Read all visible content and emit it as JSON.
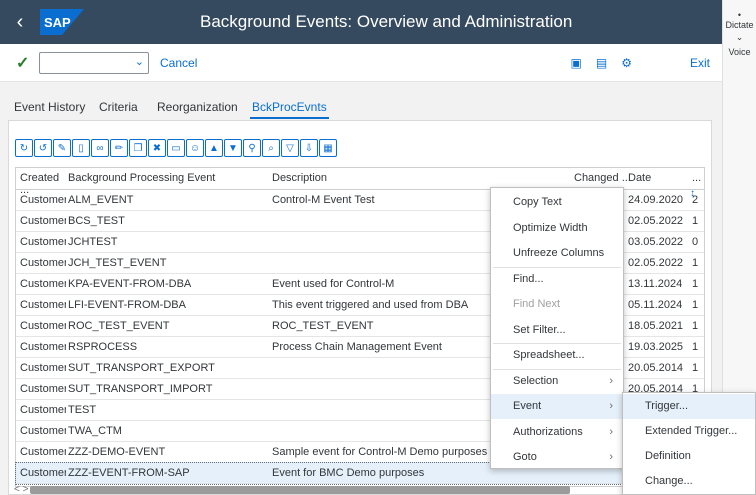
{
  "shell": {
    "title": "Background Events: Overview and Administration",
    "back_icon": "chevron-left-icon",
    "logo_text": "SAP"
  },
  "side_panel": {
    "dictate": "Dictate",
    "voice": "Voice"
  },
  "toolbar": {
    "cancel": "Cancel",
    "exit": "Exit",
    "command_value": ""
  },
  "tabs": [
    {
      "label": "Event History"
    },
    {
      "label": "Criteria"
    },
    {
      "label": "Reorganization"
    },
    {
      "label": "BckProcEvnts",
      "active": true
    }
  ],
  "table": {
    "columns": [
      "Created ...",
      "Background Processing Event",
      "Description",
      "Changed ...",
      "Date",
      "..."
    ],
    "rows": [
      {
        "created": "Customer",
        "event": "ALM_EVENT",
        "description": "Control-M Event Test",
        "date": "24.09.2020",
        "extra": "2"
      },
      {
        "created": "Customer",
        "event": "BCS_TEST",
        "description": "",
        "date": "02.05.2022",
        "extra": "1"
      },
      {
        "created": "Customer",
        "event": "JCHTEST",
        "description": "",
        "date": "03.05.2022",
        "extra": "0"
      },
      {
        "created": "Customer",
        "event": "JCH_TEST_EVENT",
        "description": "",
        "date": "02.05.2022",
        "extra": "1"
      },
      {
        "created": "Customer",
        "event": "KPA-EVENT-FROM-DBA",
        "description": "Event used for Control-M",
        "date": "13.11.2024",
        "extra": "1"
      },
      {
        "created": "Customer",
        "event": "LFI-EVENT-FROM-DBA",
        "description": "This event triggered and used from DBA",
        "date": "05.11.2024",
        "extra": "1"
      },
      {
        "created": "Customer",
        "event": "ROC_TEST_EVENT",
        "description": "ROC_TEST_EVENT",
        "date": "18.05.2021",
        "extra": "1"
      },
      {
        "created": "Customer",
        "event": "RSPROCESS",
        "description": "Process Chain Management Event",
        "date": "19.03.2025",
        "extra": "1"
      },
      {
        "created": "Customer",
        "event": "SUT_TRANSPORT_EXPORT",
        "description": "",
        "date": "20.05.2014",
        "extra": "1"
      },
      {
        "created": "Customer",
        "event": "SUT_TRANSPORT_IMPORT",
        "description": "",
        "date": "20.05.2014",
        "extra": "1"
      },
      {
        "created": "Customer",
        "event": "TEST",
        "description": "",
        "date": "",
        "extra": ""
      },
      {
        "created": "Customer",
        "event": "TWA_CTM",
        "description": "",
        "date": "",
        "extra": ""
      },
      {
        "created": "Customer",
        "event": "ZZZ-DEMO-EVENT",
        "description": "Sample event for Control-M Demo purposes",
        "date": "",
        "extra": ""
      },
      {
        "created": "Customer",
        "event": "ZZZ-EVENT-FROM-SAP",
        "description": "Event for BMC Demo purposes",
        "date": "",
        "extra": "",
        "selected": true
      }
    ]
  },
  "context_menu": {
    "items": [
      {
        "label": "Copy Text"
      },
      {
        "label": "Optimize Width"
      },
      {
        "label": "Unfreeze Columns"
      },
      {
        "label": "Find..."
      },
      {
        "label": "Find Next",
        "disabled": true
      },
      {
        "label": "Set Filter..."
      },
      {
        "label": "Spreadsheet..."
      },
      {
        "label": "Selection",
        "submenu": true
      },
      {
        "label": "Event",
        "submenu": true,
        "highlighted": true
      },
      {
        "label": "Authorizations",
        "submenu": true
      },
      {
        "label": "Goto",
        "submenu": true
      }
    ]
  },
  "submenu": {
    "items": [
      {
        "label": "Trigger...",
        "highlighted": true
      },
      {
        "label": "Extended Trigger..."
      },
      {
        "label": "Definition"
      },
      {
        "label": "Change..."
      }
    ]
  },
  "colors": {
    "shell_bg": "#354a5f",
    "accent": "#0a6ed1",
    "highlight": "#e5f0fa"
  }
}
